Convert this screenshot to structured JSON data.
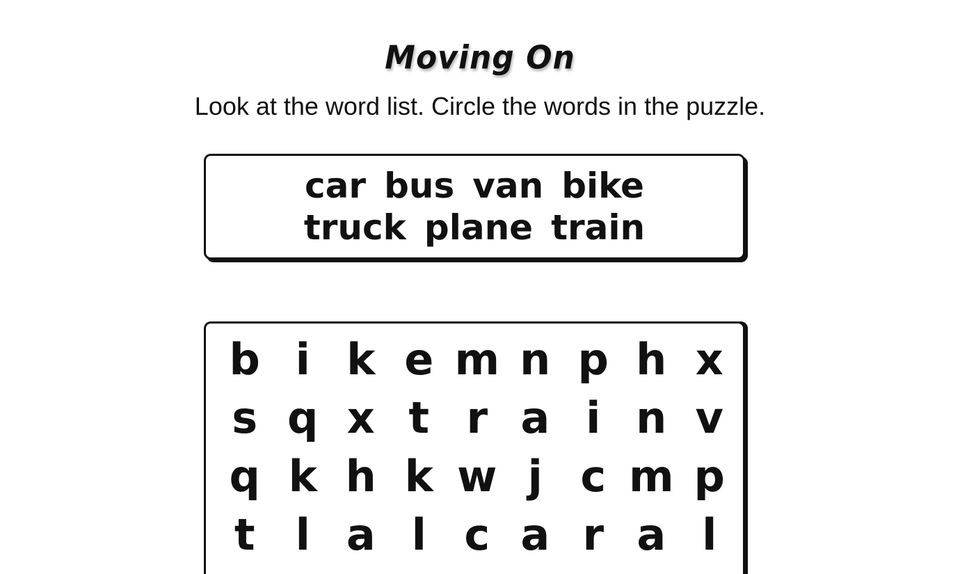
{
  "title": "Moving On",
  "instructions": "Look at the word list. Circle the words in the puzzle.",
  "word_list": {
    "line1": [
      "car",
      "bus",
      "van",
      "bike"
    ],
    "line2": [
      "truck",
      "plane",
      "train"
    ]
  },
  "puzzle": {
    "rows": [
      [
        "b",
        "i",
        "k",
        "e",
        "m",
        "n",
        "p",
        "h",
        "x"
      ],
      [
        "s",
        "q",
        "x",
        "t",
        "r",
        "a",
        "i",
        "n",
        "v"
      ],
      [
        "q",
        "k",
        "h",
        "k",
        "w",
        "j",
        "c",
        "m",
        "p"
      ],
      [
        "t",
        "l",
        "a",
        "l",
        "c",
        "a",
        "r",
        "a",
        "l"
      ]
    ]
  }
}
